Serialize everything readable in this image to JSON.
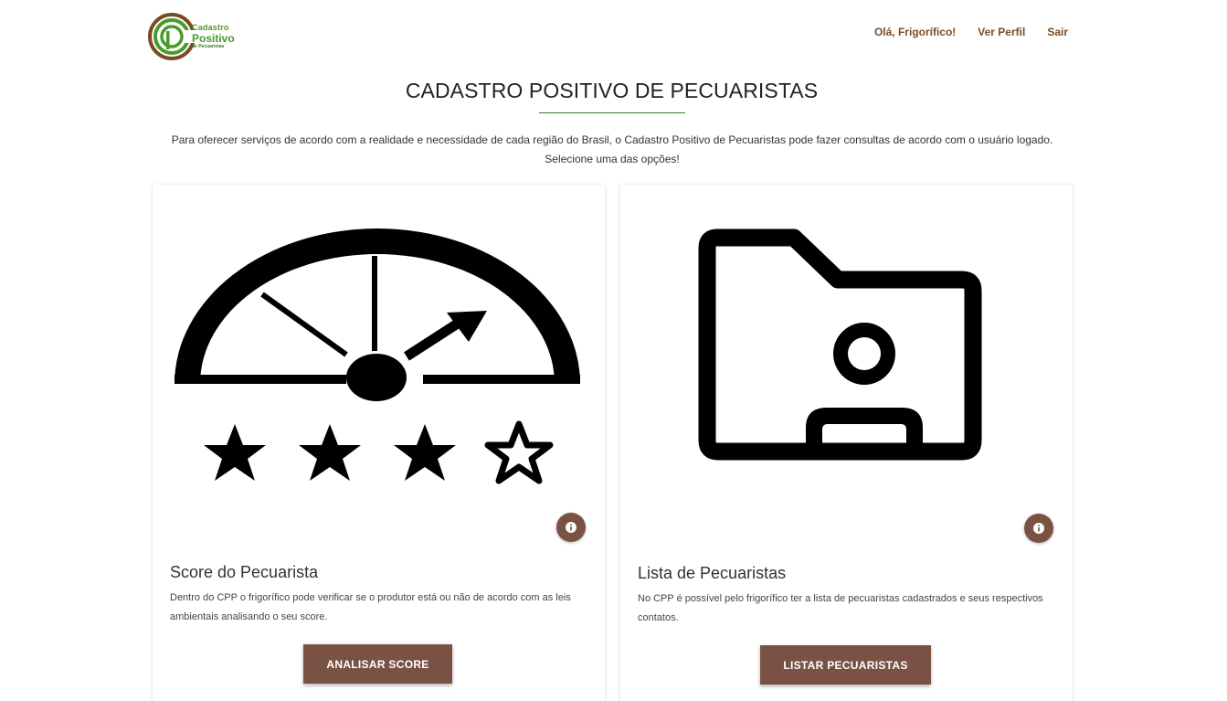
{
  "brand": {
    "logo_line1": "Cadastro",
    "logo_line2": "Positivo",
    "logo_line3": "de Pecuaristas",
    "green": "#4a9a2c",
    "brown": "#7a4b22"
  },
  "nav": {
    "greeting": "Olá, Frigorífico!",
    "profile": "Ver Perfil",
    "logout": "Sair"
  },
  "page": {
    "title": "CADASTRO POSITIVO DE PECUARISTAS",
    "intro": "Para oferecer serviços de acordo com a realidade e necessidade de cada região do Brasil, o Cadastro Positivo de Pecuaristas pode fazer consultas de acordo com o usuário logado. Selecione uma das opções!"
  },
  "cards": [
    {
      "icon": "score-gauge-icon",
      "title": "Score do Pecuarista",
      "text": "Dentro do CPP o frigorífico pode verificar se o produtor está ou não de acordo com as leis ambientais analisando o seu score.",
      "button": "ANALISAR SCORE",
      "rating_filled": 3,
      "rating_total": 4
    },
    {
      "icon": "user-folder-icon",
      "title": "Lista de Pecuaristas",
      "text": "No CPP é possível pelo frigorífico ter a lista de pecuaristas cadastrados e seus respectivos contatos.",
      "button": "LISTAR PECUARISTAS"
    }
  ],
  "colors": {
    "button": "#7a5244",
    "underline": "#3d7a25"
  }
}
